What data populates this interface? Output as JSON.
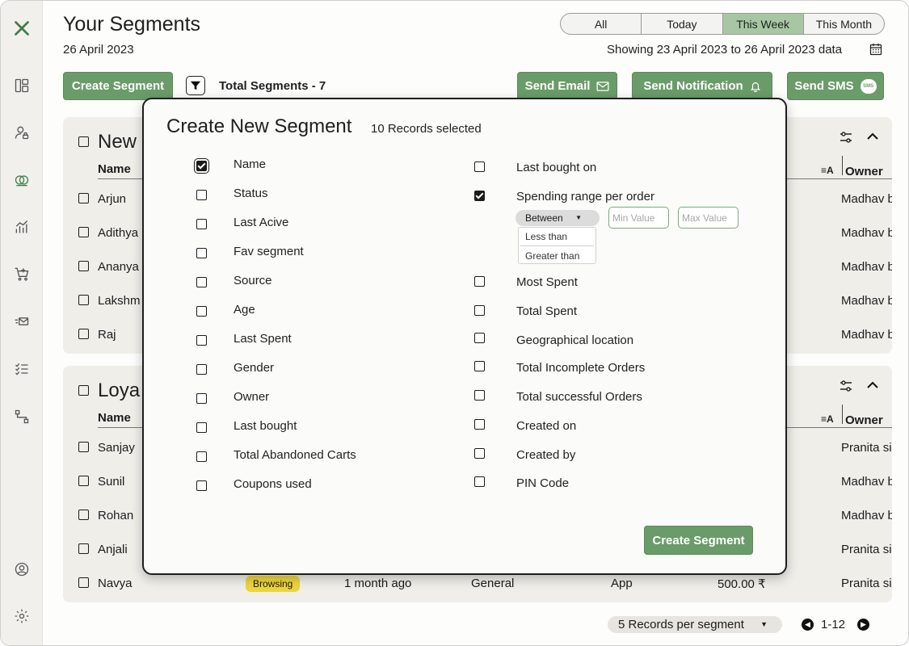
{
  "header": {
    "title": "Your Segments",
    "date": "26 April 2023",
    "range_tabs": [
      "All",
      "Today",
      "This Week",
      "This Month"
    ],
    "active_tab": "This Week",
    "showing_text": "Showing 23 April 2023 to 26 April 2023 data"
  },
  "toolbar": {
    "create_label": "Create Segment",
    "total_segments": "Total Segments - 7",
    "send_email": "Send Email",
    "send_notification": "Send Notification",
    "send_sms": "Send SMS",
    "sms_badge": "SMS"
  },
  "segments": [
    {
      "title": "New",
      "col_name": "Name",
      "col_owner": "Owner",
      "sort_icon": "≡A",
      "rows": [
        {
          "name": "Arjun",
          "owner": "Madhav b"
        },
        {
          "name": "Adithya",
          "owner": "Madhav b"
        },
        {
          "name": "Ananya",
          "owner": "Madhav b"
        },
        {
          "name": "Lakshm",
          "owner": "Madhav b"
        },
        {
          "name": "Raj",
          "owner": "Madhav b"
        }
      ]
    },
    {
      "title": "Loya",
      "col_name": "Name",
      "col_owner": "Owner",
      "sort_icon": "≡A",
      "rows": [
        {
          "name": "Sanjay",
          "owner": "Pranita si"
        },
        {
          "name": "Sunil",
          "owner": "Madhav b"
        },
        {
          "name": "Rohan",
          "owner": "Madhav b"
        },
        {
          "name": "Anjali",
          "owner": "Pranita si"
        },
        {
          "name": "Navya",
          "status": "Browsing",
          "last_active": "1 month ago",
          "segment": "General",
          "source": "App",
          "spent": "500.00 ₹",
          "owner": "Pranita si"
        }
      ]
    }
  ],
  "pagination": {
    "per_segment": "5 Records per segment",
    "range": "1-12"
  },
  "modal": {
    "title": "Create New Segment",
    "subtitle": "10 Records selected",
    "left_fields": [
      {
        "label": "Name",
        "checked": true
      },
      {
        "label": "Status",
        "checked": false
      },
      {
        "label": "Last Acive",
        "checked": false
      },
      {
        "label": "Fav segment",
        "checked": false
      },
      {
        "label": "Source",
        "checked": false
      },
      {
        "label": "Age",
        "checked": false
      },
      {
        "label": "Last Spent",
        "checked": false
      },
      {
        "label": "Gender",
        "checked": false
      },
      {
        "label": "Owner",
        "checked": false
      },
      {
        "label": "Last bought",
        "checked": false
      },
      {
        "label": "Total Abandoned Carts",
        "checked": false
      },
      {
        "label": "Coupons used",
        "checked": false
      }
    ],
    "right_fields": [
      {
        "label": "Last bought on",
        "checked": false
      },
      {
        "label": "Spending range per order",
        "checked": true
      },
      {
        "label": "Most Spent",
        "checked": false
      },
      {
        "label": "Total Spent",
        "checked": false
      },
      {
        "label": "Geographical location",
        "checked": false
      },
      {
        "label": "Total Incomplete Orders",
        "checked": false
      },
      {
        "label": "Total successful Orders",
        "checked": false
      },
      {
        "label": "Created on",
        "checked": false
      },
      {
        "label": "Created by",
        "checked": false
      },
      {
        "label": "PIN Code",
        "checked": false
      }
    ],
    "range_select": "Between",
    "range_options": [
      "Less than",
      "Greater than"
    ],
    "min_placeholder": "Min Value",
    "max_placeholder": "Max Value",
    "create_button": "Create Segment"
  },
  "colors": {
    "accent_green": "#6a9c69",
    "active_tab": "#a7c7a3",
    "badge_yellow": "#ecd53b",
    "logo_green": "#3f7d4a"
  }
}
